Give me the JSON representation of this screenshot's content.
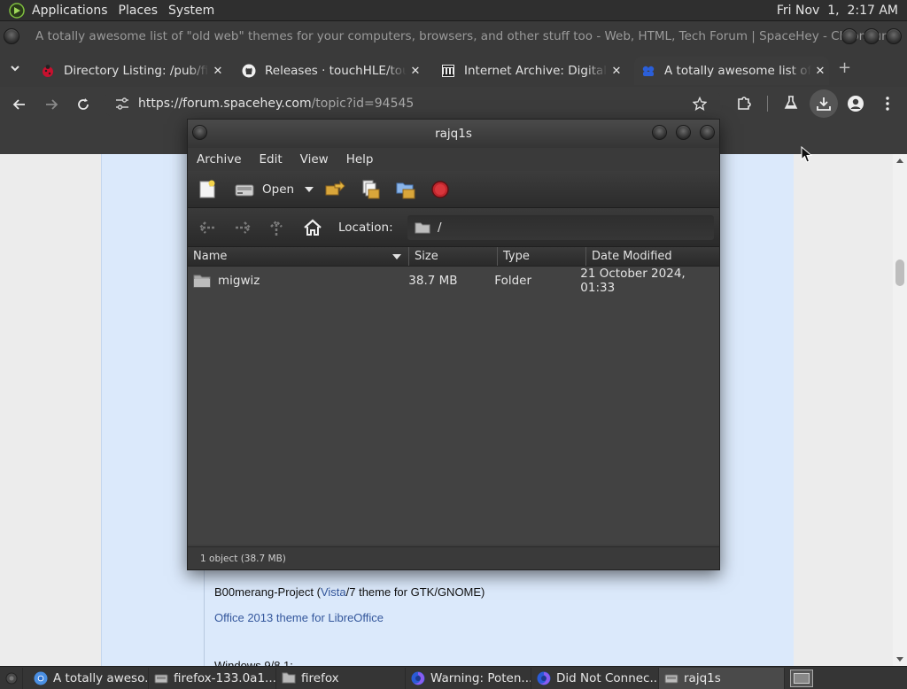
{
  "panel": {
    "menus": [
      "Applications",
      "Places",
      "System"
    ],
    "clock": "Fri Nov  1,  2:17 AM"
  },
  "window": {
    "title": "A totally awesome list of \"old web\" themes for your computers, browsers, and other stuff too - Web, HTML, Tech Forum | SpaceHey - Chromium"
  },
  "tabs": [
    {
      "label": "Directory Listing: /pub/firef",
      "icon": "ladybug-favicon"
    },
    {
      "label": "Releases · touchHLE/touchH",
      "icon": "github-favicon"
    },
    {
      "label": "Internet Archive: Digital Lib",
      "icon": "archive-favicon"
    },
    {
      "label": "A totally awesome list of \"o",
      "icon": "spacehey-favicon"
    }
  ],
  "toolbar": {
    "url_host": "https://forum.spacehey.com",
    "url_path": "/topic?id=94545"
  },
  "page": {
    "line1_text": "B00merang-Project (",
    "line1_link1": "Vista",
    "line1_mid": "/7 theme for GTK/GNOME)",
    "line2_link": "Office 2013 theme for LibreOffice",
    "line3_text": "Windows 9/8.1:"
  },
  "archive": {
    "title": "rajq1s",
    "menu": [
      "Archive",
      "Edit",
      "View",
      "Help"
    ],
    "open_label": "Open",
    "location_label": "Location:",
    "location_value": "/",
    "columns": [
      "Name",
      "Size",
      "Type",
      "Date Modified"
    ],
    "rows": [
      {
        "name": "migwiz",
        "size": "38.7 MB",
        "type": "Folder",
        "modified": "21 October 2024, 01:33"
      }
    ],
    "status": "1 object (38.7 MB)"
  },
  "taskbar": {
    "items": [
      {
        "label": "A totally aweso...",
        "icon": "chromium-icon"
      },
      {
        "label": "firefox-133.0a1....",
        "icon": "archive-manager-icon"
      },
      {
        "label": "firefox",
        "icon": "folder-icon"
      },
      {
        "label": "Warning: Poten...",
        "icon": "firefox-icon"
      },
      {
        "label": "Did Not Connec...",
        "icon": "firefox-icon"
      },
      {
        "label": "rajq1s",
        "icon": "archive-manager-icon"
      }
    ]
  },
  "colors": {
    "accent_link": "#34579c",
    "page_post_bg": "#dbe9fb",
    "dark_ui": "#3c3c3c"
  }
}
